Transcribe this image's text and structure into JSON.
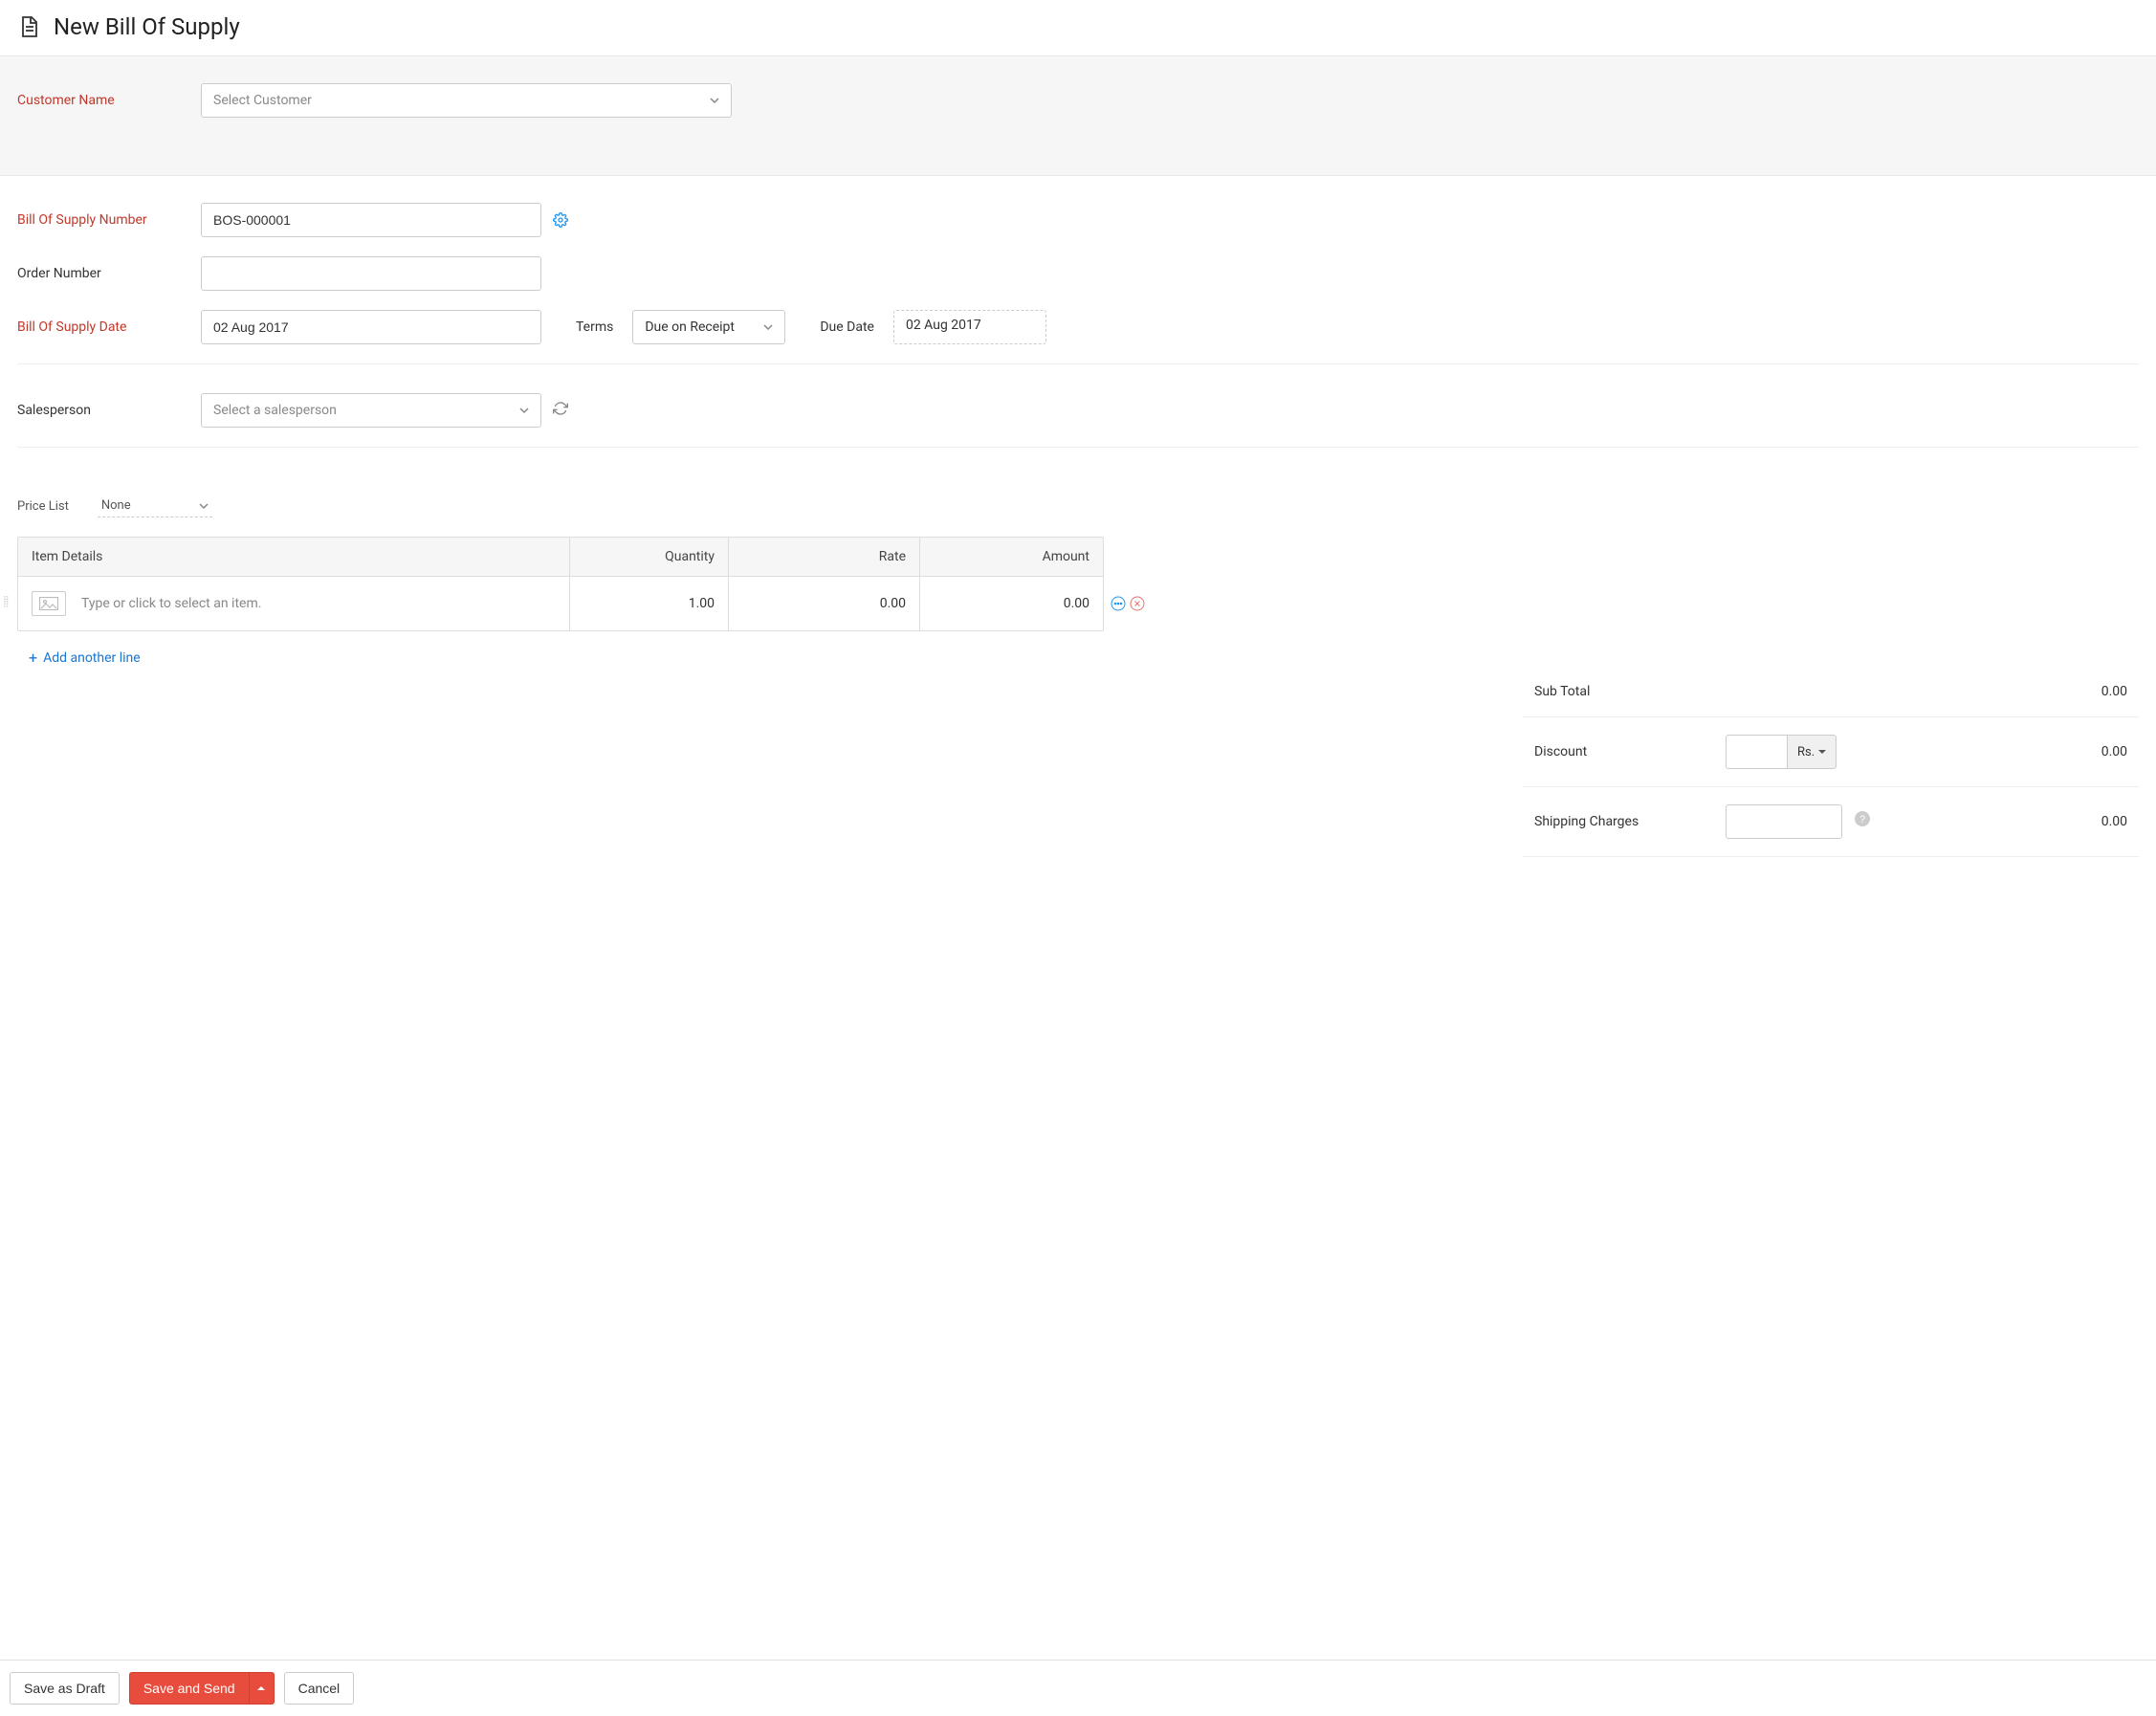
{
  "header": {
    "title": "New Bill Of Supply"
  },
  "form": {
    "customer": {
      "label": "Customer Name",
      "placeholder": "Select Customer"
    },
    "bos_number": {
      "label": "Bill Of Supply Number",
      "value": "BOS-000001"
    },
    "order_number": {
      "label": "Order Number",
      "value": ""
    },
    "bos_date": {
      "label": "Bill Of Supply Date",
      "value": "02 Aug 2017"
    },
    "terms": {
      "label": "Terms",
      "value": "Due on Receipt"
    },
    "due_date": {
      "label": "Due Date",
      "value": "02 Aug 2017"
    },
    "salesperson": {
      "label": "Salesperson",
      "placeholder": "Select a salesperson"
    }
  },
  "pricelist": {
    "label": "Price List",
    "value": "None"
  },
  "items": {
    "headers": {
      "item": "Item Details",
      "qty": "Quantity",
      "rate": "Rate",
      "amount": "Amount"
    },
    "placeholder": "Type or click to select an item.",
    "rows": [
      {
        "qty": "1.00",
        "rate": "0.00",
        "amount": "0.00"
      }
    ],
    "add_line": "Add another line"
  },
  "totals": {
    "subtotal": {
      "label": "Sub Total",
      "value": "0.00"
    },
    "discount": {
      "label": "Discount",
      "currency": "Rs.",
      "input": "",
      "value": "0.00"
    },
    "shipping": {
      "label": "Shipping Charges",
      "input": "",
      "value": "0.00"
    }
  },
  "footer": {
    "draft": "Save as Draft",
    "save_send": "Save and Send",
    "cancel": "Cancel"
  }
}
